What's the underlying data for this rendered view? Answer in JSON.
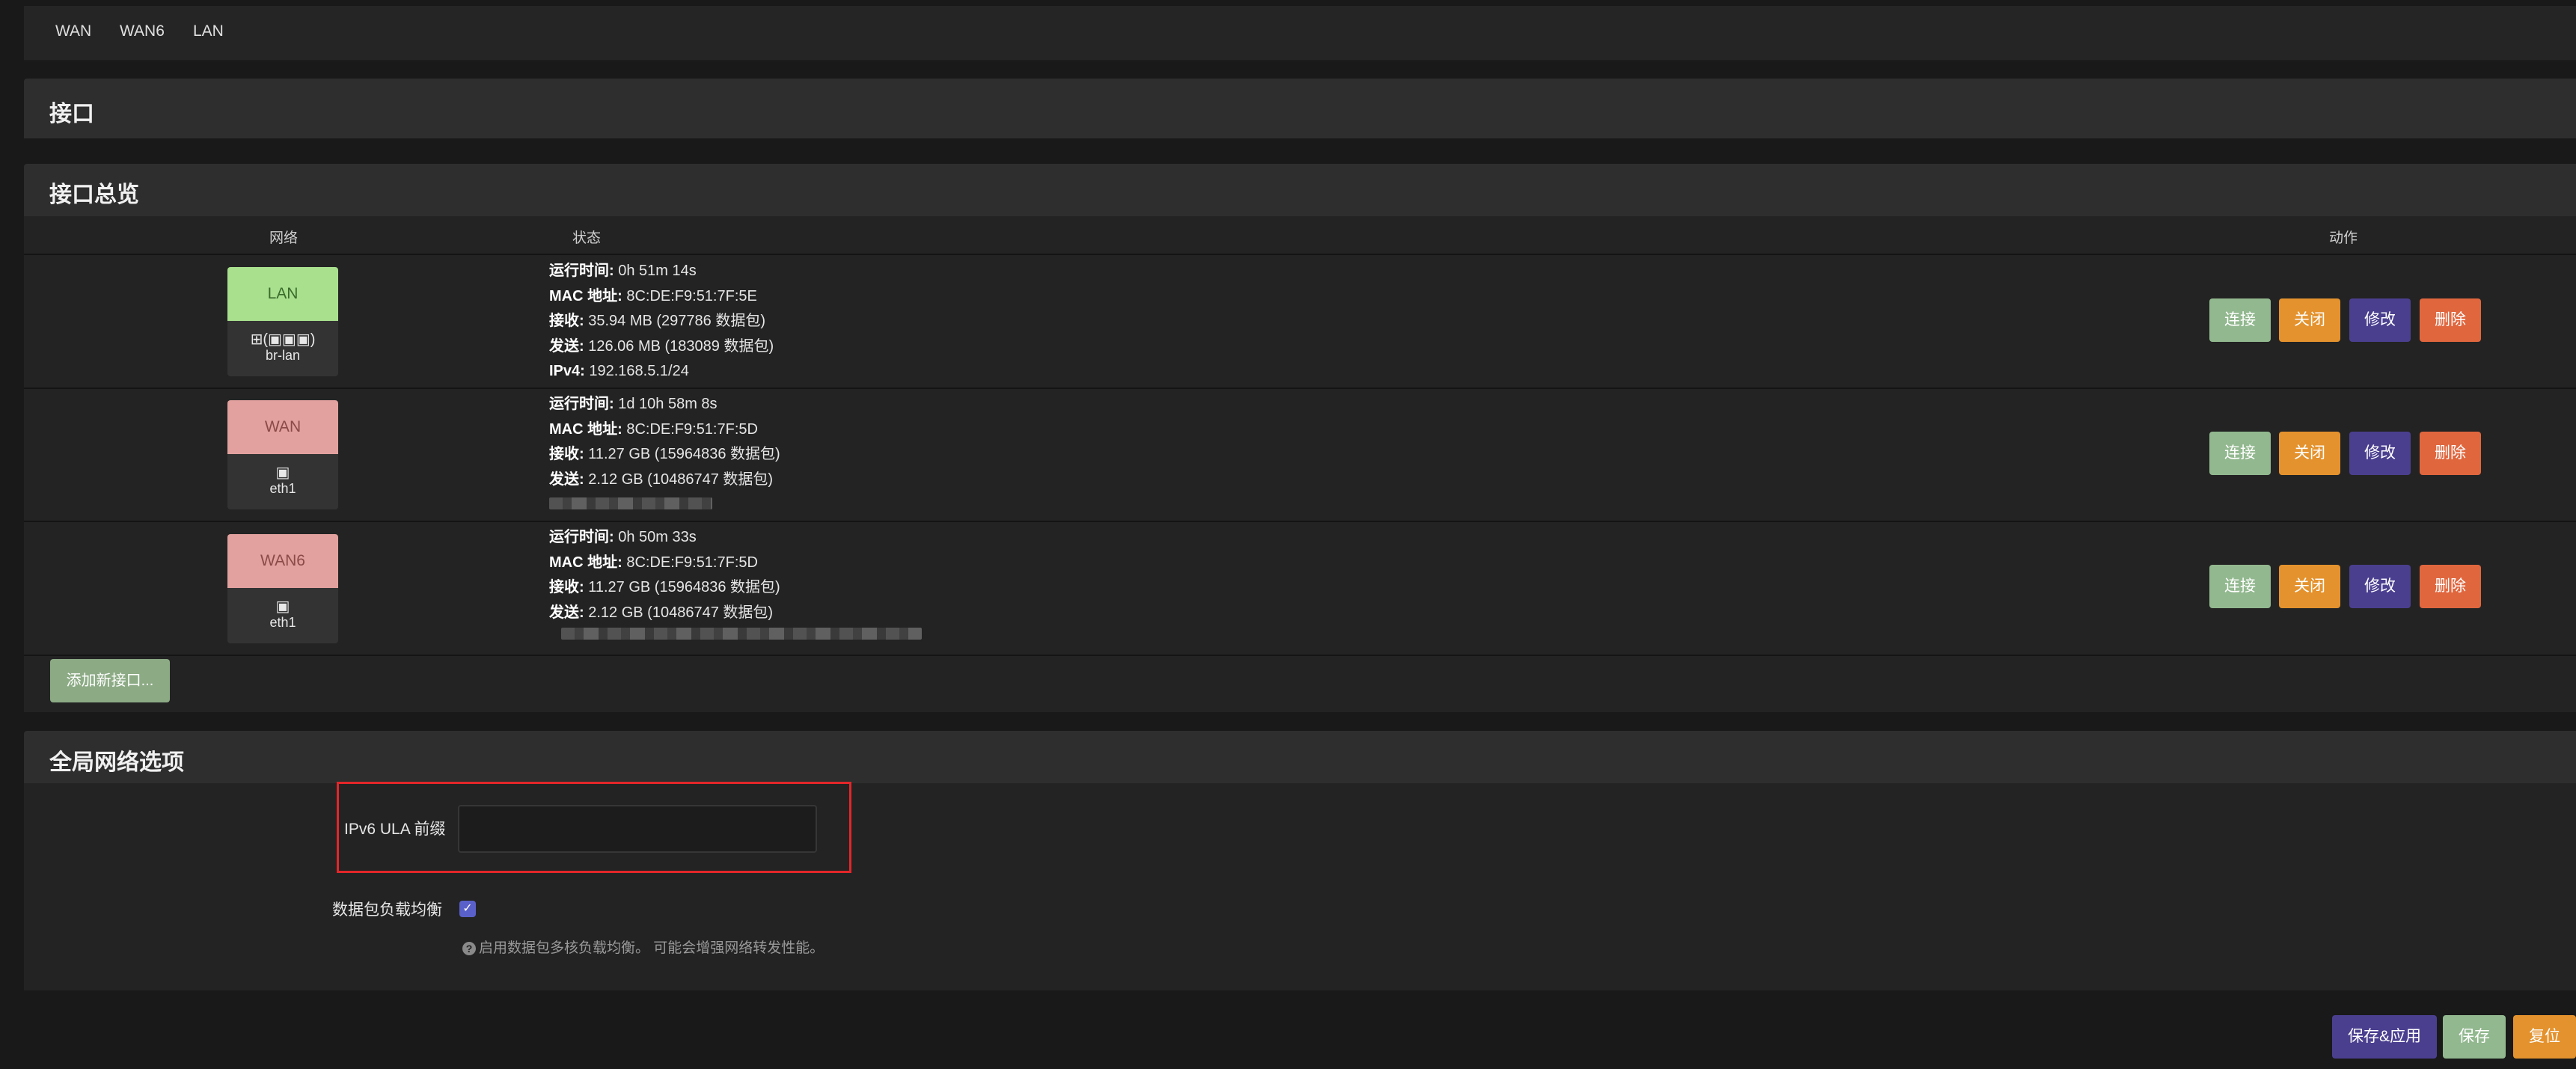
{
  "tabs": [
    "WAN",
    "WAN6",
    "LAN"
  ],
  "interfaces_section": {
    "title": "接口"
  },
  "overview": {
    "title": "接口总览",
    "columns": {
      "network": "网络",
      "status": "状态",
      "actions": "动作"
    },
    "rows": [
      {
        "name": "LAN",
        "color": "#a8e08e",
        "icon_label": "(",
        "icon_label_end": ")",
        "device": "br-lan",
        "uptime_label": "运行时间:",
        "uptime": "0h 51m 14s",
        "mac_label": "MAC 地址:",
        "mac": "8C:DE:F9:51:7F:5E",
        "rx_label": "接收:",
        "rx": "35.94 MB (297786 数据包)",
        "tx_label": "发送:",
        "tx": "126.06 MB (183089 数据包)",
        "ipv4_label": "IPv4:",
        "ipv4": "192.168.5.1/24"
      },
      {
        "name": "WAN",
        "color": "#e2a19e",
        "device": "eth1",
        "uptime_label": "运行时间:",
        "uptime": "1d 10h 58m 8s",
        "mac_label": "MAC 地址:",
        "mac": "8C:DE:F9:51:7F:5D",
        "rx_label": "接收:",
        "rx": "11.27 GB (15964836 数据包)",
        "tx_label": "发送:",
        "tx": "2.12 GB (10486747 数据包)"
      },
      {
        "name": "WAN6",
        "color": "#e2a19e",
        "device": "eth1",
        "uptime_label": "运行时间:",
        "uptime": "0h 50m 33s",
        "mac_label": "MAC 地址:",
        "mac": "8C:DE:F9:51:7F:5D",
        "rx_label": "接收:",
        "rx": "11.27 GB (15964836 数据包)",
        "tx_label": "发送:",
        "tx": "2.12 GB (10486747 数据包)"
      }
    ],
    "buttons": {
      "connect": "连接",
      "close": "关闭",
      "edit": "修改",
      "delete": "删除"
    },
    "add_button": "添加新接口..."
  },
  "global": {
    "title": "全局网络选项",
    "ula_label": "IPv6 ULA 前缀",
    "ula_value": "",
    "lb_label": "数据包负载均衡",
    "lb_checked": true,
    "lb_hint": "启用数据包多核负载均衡。 可能会增强网络转发性能。"
  },
  "footer": {
    "save_apply": "保存&应用",
    "save": "保存",
    "reset": "复位"
  },
  "icons": {
    "bridge": "network-bridge-icon",
    "port": "ethernet-port-icon",
    "help": "question-circle-icon",
    "check": "checkmark-icon"
  }
}
